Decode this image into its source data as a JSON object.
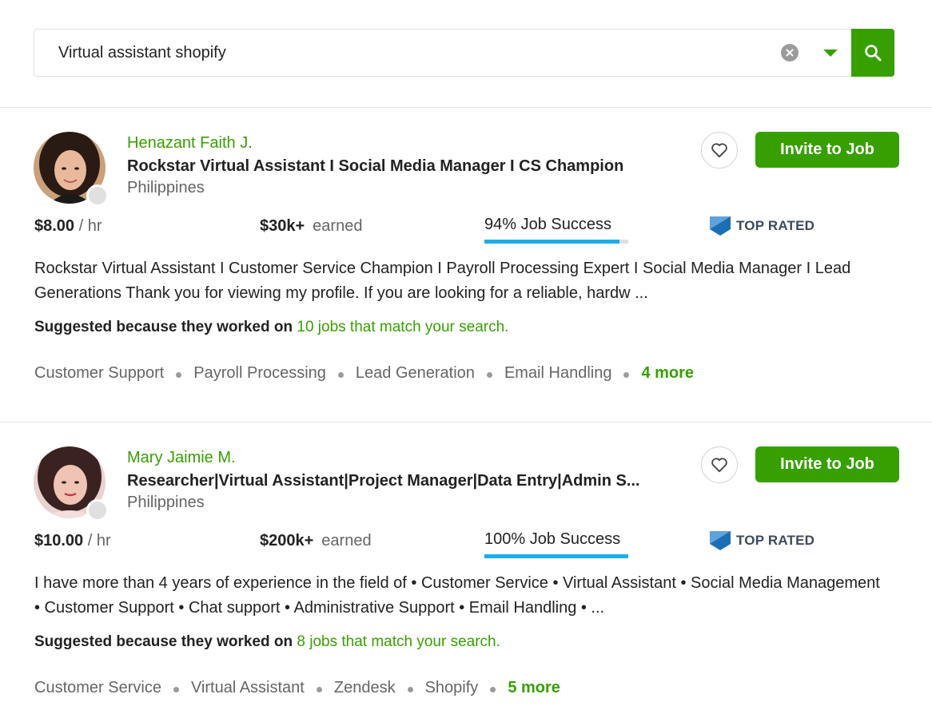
{
  "search": {
    "value": "Virtual assistant shopify"
  },
  "freelancers": [
    {
      "name": "Henazant Faith J.",
      "title": "Rockstar Virtual Assistant I Social Media Manager I CS Champion",
      "location": "Philippines",
      "rate": "$8.00",
      "rate_unit": "/ hr",
      "earned": "$30k+",
      "earned_label": "earned",
      "job_success": "94% Job Success",
      "job_success_pct": 94,
      "badge": "TOP RATED",
      "invite_label": "Invite to Job",
      "overview": "Rockstar Virtual Assistant I Customer Service Champion I Payroll Processing Expert I Social Media Manager I Lead Generations Thank you for viewing my profile. If you are looking for a reliable, hardw ...",
      "suggested_lead": "Suggested because they worked on",
      "suggested_link": "10 jobs that match your search.",
      "skills": [
        "Customer Support",
        "Payroll Processing",
        "Lead Generation",
        "Email Handling"
      ],
      "more": "4 more"
    },
    {
      "name": "Mary Jaimie M.",
      "title": "Researcher|Virtual Assistant|Project Manager|Data Entry|Admin S...",
      "location": "Philippines",
      "rate": "$10.00",
      "rate_unit": "/ hr",
      "earned": "$200k+",
      "earned_label": "earned",
      "job_success": "100% Job Success",
      "job_success_pct": 100,
      "badge": "TOP RATED",
      "invite_label": "Invite to Job",
      "overview": "I have more than 4 years of experience in the field of • Customer Service • Virtual Assistant • Social Media Management • Customer Support • Chat support • Administrative Support • Email Handling • ...",
      "suggested_lead": "Suggested because they worked on",
      "suggested_link": "8 jobs that match your search.",
      "skills": [
        "Customer Service",
        "Virtual Assistant",
        "Zendesk",
        "Shopify"
      ],
      "more": "5 more"
    }
  ],
  "colors": {
    "brand_green": "#37a000",
    "progress_blue": "#1caeea",
    "badge_blue": "#1d6fb5"
  }
}
